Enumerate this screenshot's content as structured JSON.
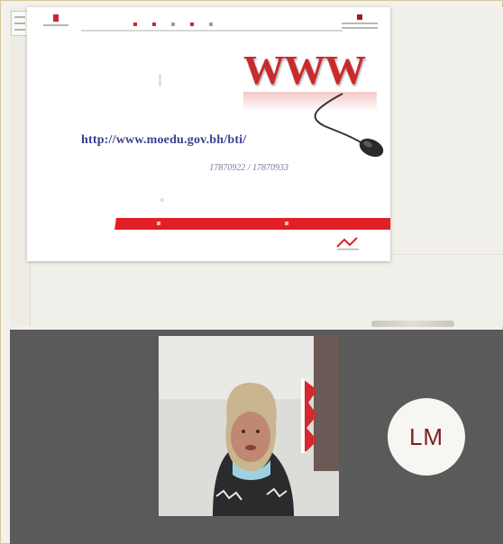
{
  "slide": {
    "logo_text": "WWW",
    "url": "http://www.moedu.gov.bh/bti/",
    "phones": "17870922 / 17870933"
  },
  "participant": {
    "initials": "LM"
  },
  "colors": {
    "brand_red": "#e11f26",
    "url_blue": "#3c3f8f",
    "panel_gray": "#5a5a5a",
    "avatar_text": "#7f1d22"
  },
  "icons": {
    "mouse": "computer-mouse-icon"
  }
}
